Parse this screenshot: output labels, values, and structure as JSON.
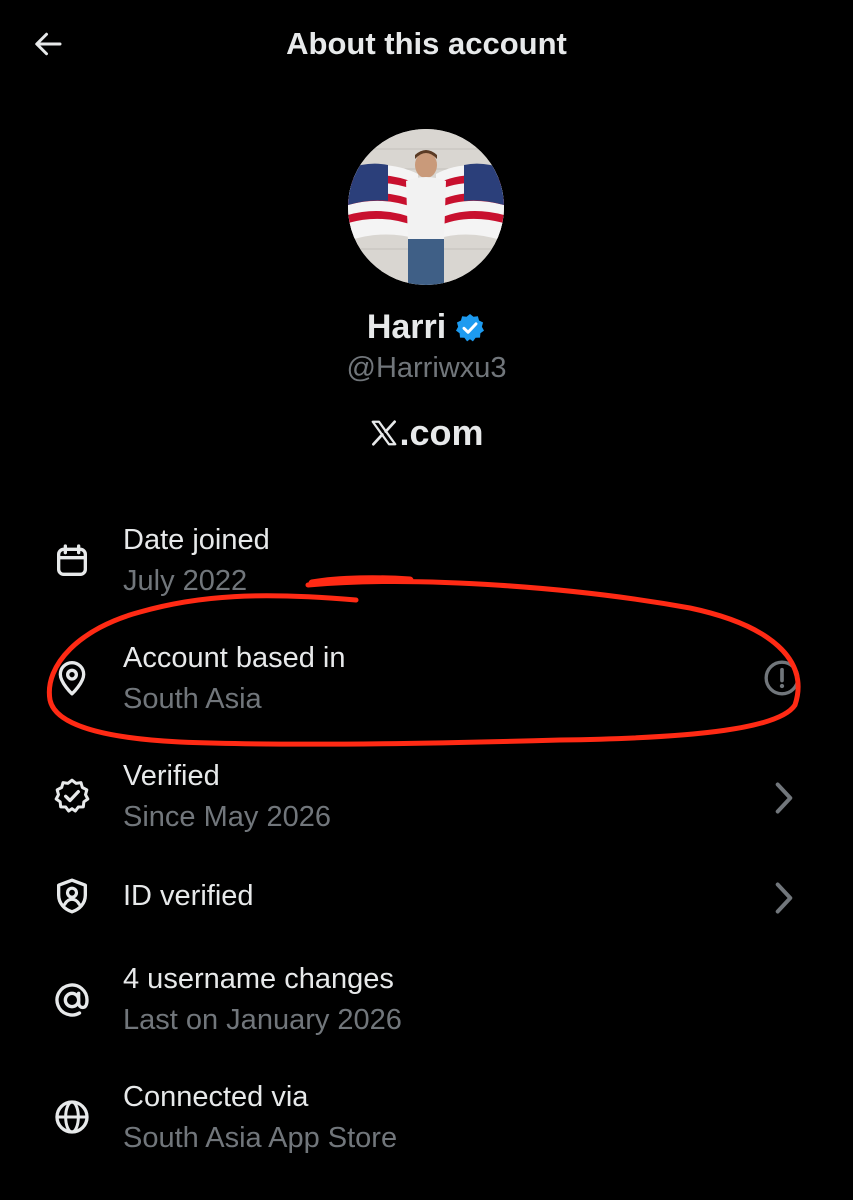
{
  "header": {
    "title": "About this account",
    "back_icon": "arrow-left-icon"
  },
  "profile": {
    "display_name": "Harri",
    "handle": "@Harriwxu3",
    "site": ".com",
    "site_logo": "X",
    "verified_badge_color": "#1d9bf0"
  },
  "rows": [
    {
      "icon": "calendar-icon",
      "title": "Date joined",
      "subtitle": "July 2022"
    },
    {
      "icon": "location-pin-icon",
      "title": "Account based in",
      "subtitle": "South Asia",
      "trailing_icon": "info-icon"
    },
    {
      "icon": "verified-badge-icon",
      "title": "Verified",
      "subtitle": "Since May 2026",
      "trailing_icon": "chevron-right-icon"
    },
    {
      "icon": "id-shield-icon",
      "title": "ID verified",
      "trailing_icon": "chevron-right-icon"
    },
    {
      "icon": "at-sign-icon",
      "title": "4 username changes",
      "subtitle": "Last on January 2026"
    },
    {
      "icon": "globe-icon",
      "title": "Connected via",
      "subtitle": "South Asia App Store"
    }
  ],
  "colors": {
    "background": "#000000",
    "primary_text": "#e7e9ea",
    "secondary_text": "#71767b",
    "annotation_stroke": "#ff2a14"
  }
}
